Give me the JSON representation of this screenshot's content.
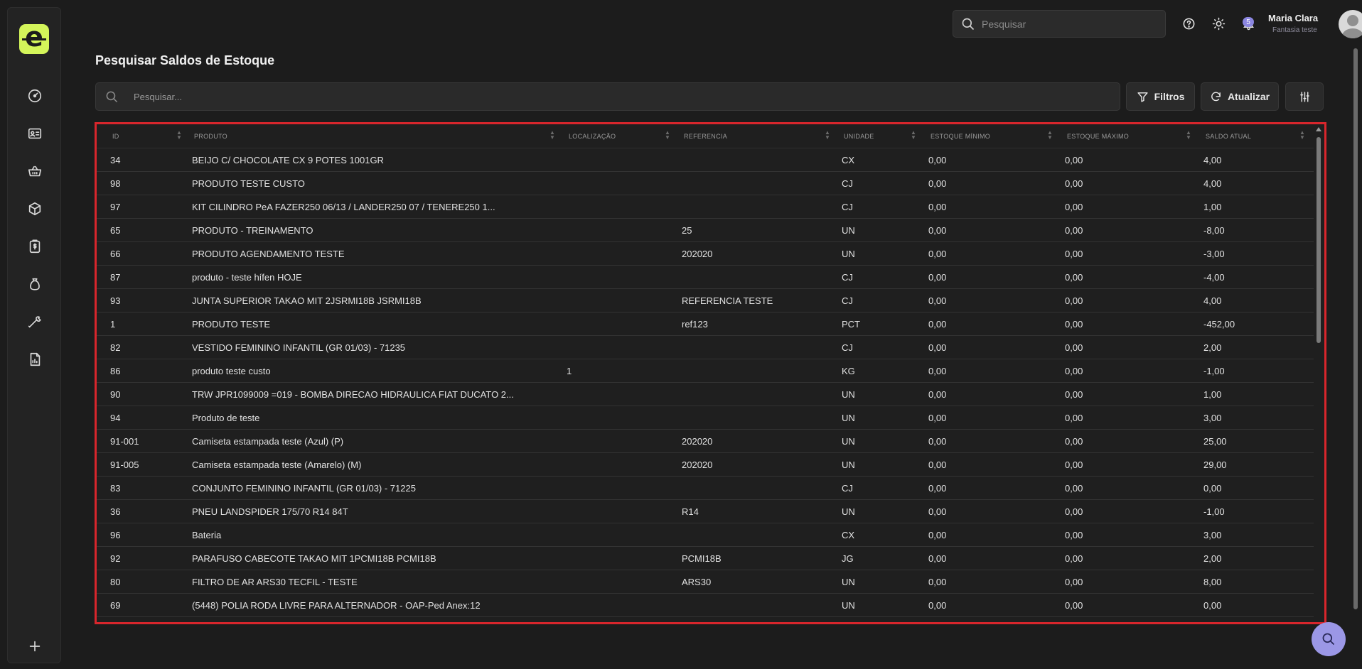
{
  "header": {
    "search_placeholder": "Pesquisar",
    "notification_count": "5",
    "user_name": "Maria Clara",
    "user_subtitle": "Fantasia teste"
  },
  "page": {
    "title": "Pesquisar Saldos de Estoque",
    "search_placeholder": "Pesquisar...",
    "filters_label": "Filtros",
    "refresh_label": "Atualizar"
  },
  "table": {
    "columns": [
      "ID",
      "PRODUTO",
      "LOCALIZAÇÃO",
      "REFERENCIA",
      "UNIDADE",
      "ESTOQUE MÍNIMO",
      "ESTOQUE MÁXIMO",
      "SALDO ATUAL"
    ],
    "rows": [
      [
        "34",
        "BEIJO C/ CHOCOLATE CX 9 POTES 1001GR",
        "",
        "",
        "CX",
        "0,00",
        "0,00",
        "4,00"
      ],
      [
        "98",
        "PRODUTO TESTE CUSTO",
        "",
        "",
        "CJ",
        "0,00",
        "0,00",
        "4,00"
      ],
      [
        "97",
        "KIT CILINDRO PeA FAZER250 06/13 / LANDER250 07 / TENERE250 1...",
        "",
        "",
        "CJ",
        "0,00",
        "0,00",
        "1,00"
      ],
      [
        "65",
        "PRODUTO - TREINAMENTO",
        "",
        "25",
        "UN",
        "0,00",
        "0,00",
        "-8,00"
      ],
      [
        "66",
        "PRODUTO AGENDAMENTO TESTE",
        "",
        "202020",
        "UN",
        "0,00",
        "0,00",
        "-3,00"
      ],
      [
        "87",
        "produto - teste hífen HOJE",
        "",
        "",
        "CJ",
        "0,00",
        "0,00",
        "-4,00"
      ],
      [
        "93",
        "JUNTA SUPERIOR TAKAO MIT 2JSRMI18B JSRMI18B",
        "",
        "REFERENCIA TESTE",
        "CJ",
        "0,00",
        "0,00",
        "4,00"
      ],
      [
        "1",
        "PRODUTO TESTE",
        "",
        "ref123",
        "PCT",
        "0,00",
        "0,00",
        "-452,00"
      ],
      [
        "82",
        "VESTIDO FEMININO INFANTIL (GR 01/03) - 71235",
        "",
        "",
        "CJ",
        "0,00",
        "0,00",
        "2,00"
      ],
      [
        "86",
        "produto teste custo",
        "1",
        "",
        "KG",
        "0,00",
        "0,00",
        "-1,00"
      ],
      [
        "90",
        "TRW JPR1099009 =019 - BOMBA DIRECAO HIDRAULICA FIAT DUCATO 2...",
        "",
        "",
        "UN",
        "0,00",
        "0,00",
        "1,00"
      ],
      [
        "94",
        "Produto de teste",
        "",
        "",
        "UN",
        "0,00",
        "0,00",
        "3,00"
      ],
      [
        "91-001",
        "Camiseta estampada teste (Azul) (P)",
        "",
        "202020",
        "UN",
        "0,00",
        "0,00",
        "25,00"
      ],
      [
        "91-005",
        "Camiseta estampada teste (Amarelo) (M)",
        "",
        "202020",
        "UN",
        "0,00",
        "0,00",
        "29,00"
      ],
      [
        "83",
        "CONJUNTO FEMININO INFANTIL (GR 01/03) - 71225",
        "",
        "",
        "CJ",
        "0,00",
        "0,00",
        "0,00"
      ],
      [
        "36",
        "PNEU LANDSPIDER 175/70 R14 84T",
        "",
        "R14",
        "UN",
        "0,00",
        "0,00",
        "-1,00"
      ],
      [
        "96",
        "Bateria",
        "",
        "",
        "CX",
        "0,00",
        "0,00",
        "3,00"
      ],
      [
        "92",
        "PARAFUSO CABECOTE TAKAO MIT 1PCMI18B PCMI18B",
        "",
        "PCMI18B",
        "JG",
        "0,00",
        "0,00",
        "2,00"
      ],
      [
        "80",
        "FILTRO DE AR ARS30 TECFIL - TESTE",
        "",
        "ARS30",
        "UN",
        "0,00",
        "0,00",
        "8,00"
      ],
      [
        "69",
        "(5448) POLIA RODA LIVRE PARA ALTERNADOR - OAP-Ped Anex:12",
        "",
        "",
        "UN",
        "0,00",
        "0,00",
        "0,00"
      ]
    ]
  },
  "colors": {
    "accent_logo": "#d4f55a",
    "selection_border": "#d8262c",
    "fab": "#9b97e6"
  }
}
